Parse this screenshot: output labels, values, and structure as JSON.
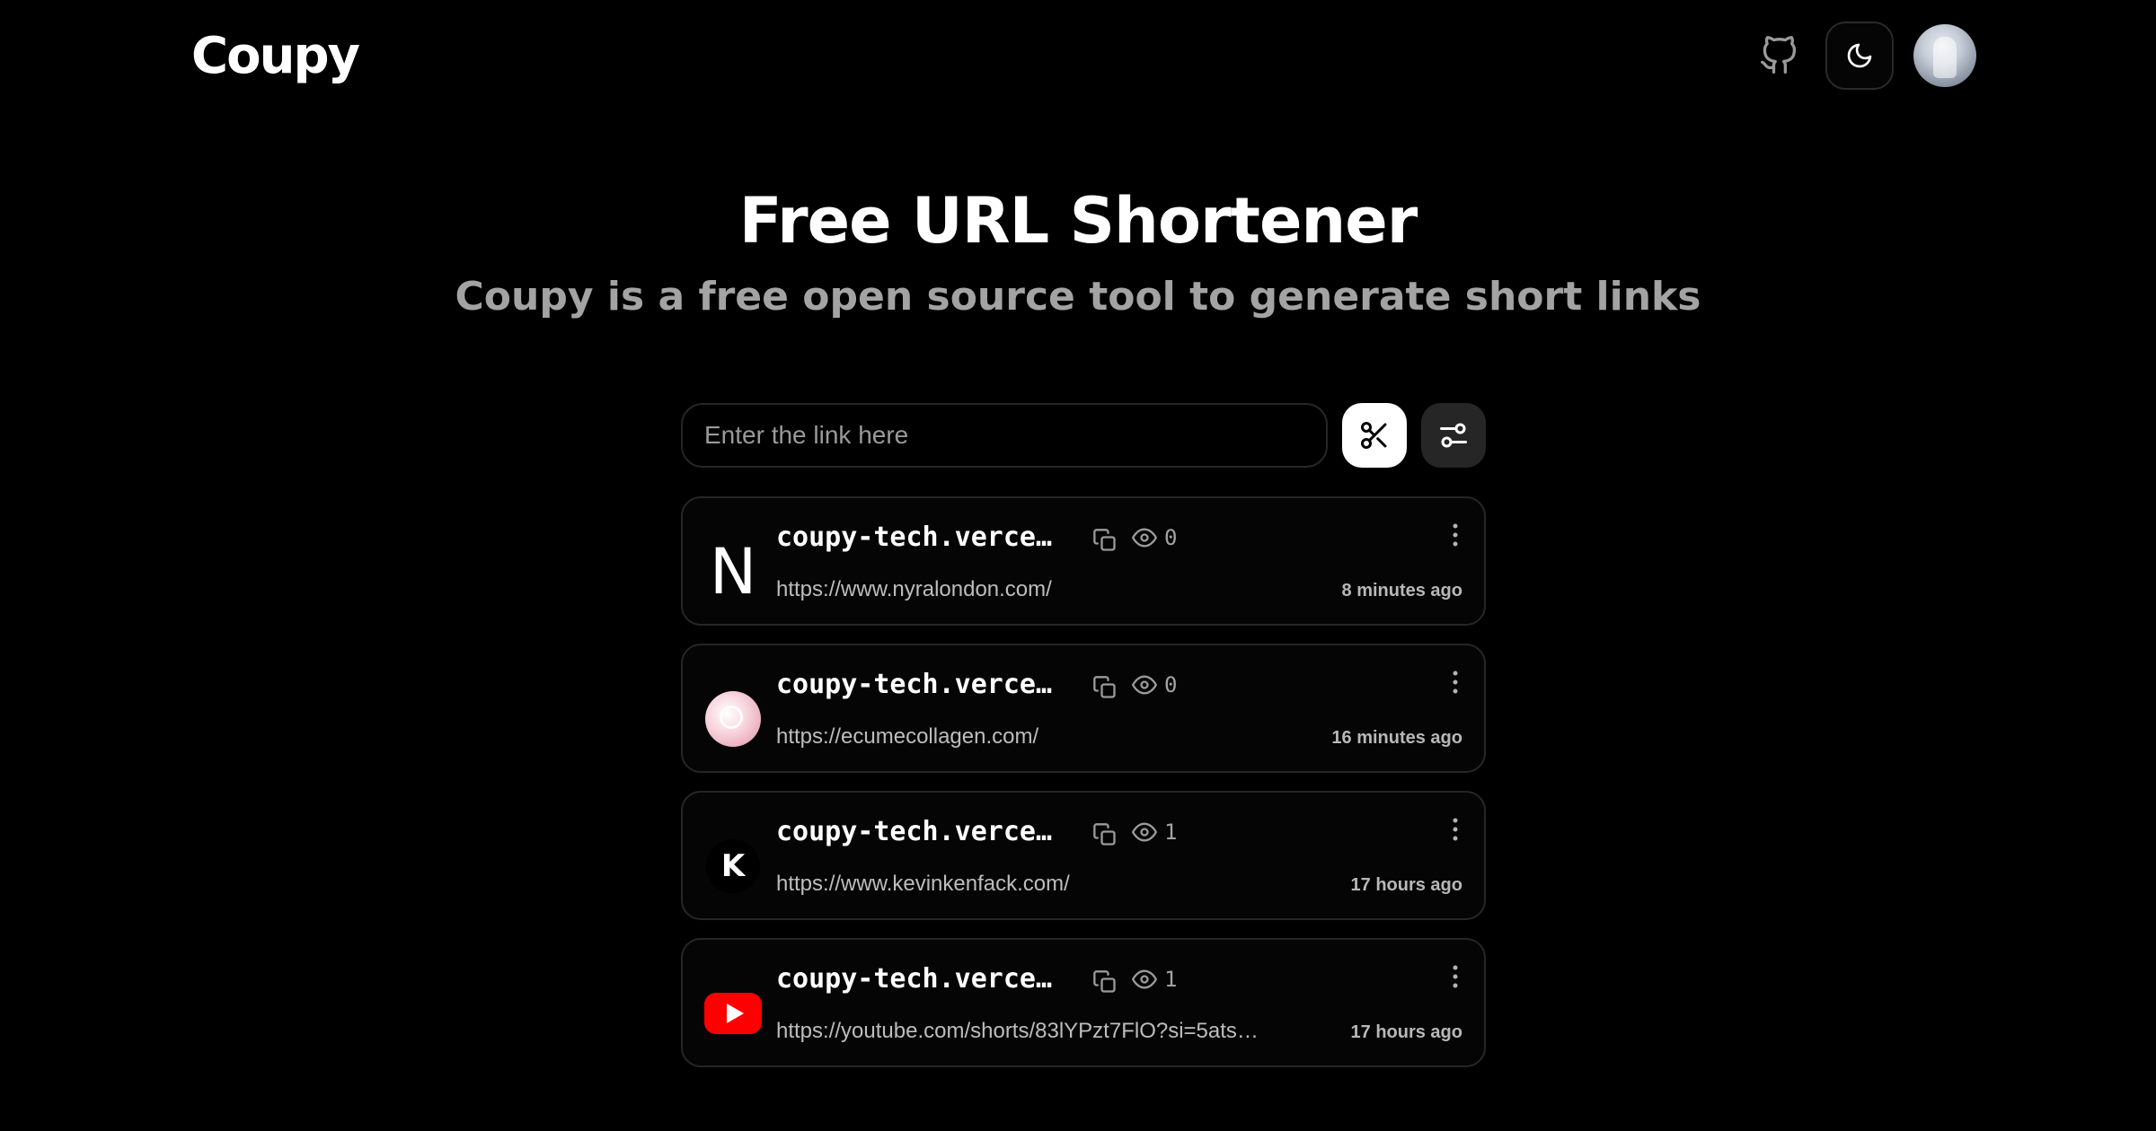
{
  "header": {
    "logo": "Coupy",
    "icons": {
      "github": "github-icon",
      "theme": "moon-icon",
      "avatar": "user-avatar"
    }
  },
  "hero": {
    "title": "Free URL Shortener",
    "subtitle": "Coupy is a free open source tool to generate short links"
  },
  "form": {
    "placeholder": "Enter the link here",
    "value": "",
    "icons": {
      "shorten": "scissors-icon",
      "options": "sliders-icon"
    }
  },
  "links": [
    {
      "favicon": "N",
      "favicon_type": "letter-n",
      "short": "coupy-tech.verce…",
      "views": "0",
      "original": "https://www.nyralondon.com/",
      "time": "8 minutes ago"
    },
    {
      "favicon": "",
      "favicon_type": "pink-logo",
      "short": "coupy-tech.verce…",
      "views": "0",
      "original": "https://ecumecollagen.com/",
      "time": "16 minutes ago"
    },
    {
      "favicon": "K",
      "favicon_type": "letter-k",
      "short": "coupy-tech.verce…",
      "views": "1",
      "original": "https://www.kevinkenfack.com/",
      "time": "17 hours ago"
    },
    {
      "favicon": "",
      "favicon_type": "youtube-logo",
      "short": "coupy-tech.verce…",
      "views": "1",
      "original": "https://youtube.com/shorts/83lYPzt7FlO?si=5ats…",
      "time": "17 hours ago"
    }
  ],
  "colors": {
    "background": "#000000",
    "card_border": "#262626",
    "muted_text": "#a3a3a3",
    "youtube_red": "#ff0000"
  }
}
